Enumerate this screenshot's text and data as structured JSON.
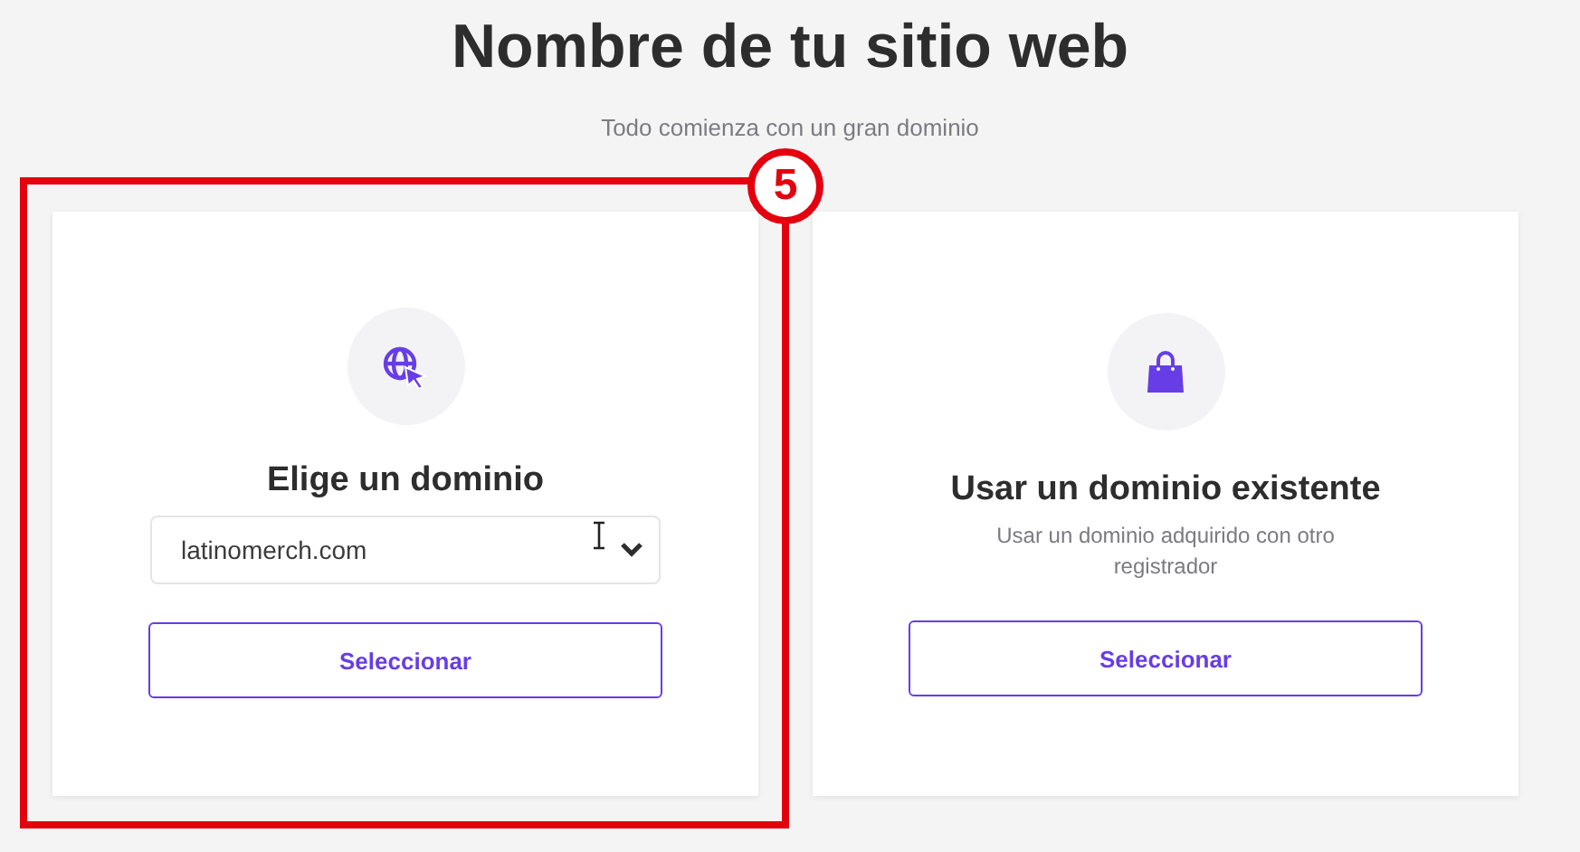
{
  "header": {
    "title": "Nombre de tu sitio web",
    "subtitle": "Todo comienza con un gran dominio"
  },
  "options": [
    {
      "kind": "select",
      "title": "Elige un dominio",
      "select": {
        "value": "latinomerch.com"
      },
      "button": "Seleccionar",
      "annotation_label": "5"
    },
    {
      "kind": "existing",
      "title": "Usar un dominio existente",
      "description": "Usar un dominio adquirido con otro registrador",
      "button": "Seleccionar"
    }
  ]
}
